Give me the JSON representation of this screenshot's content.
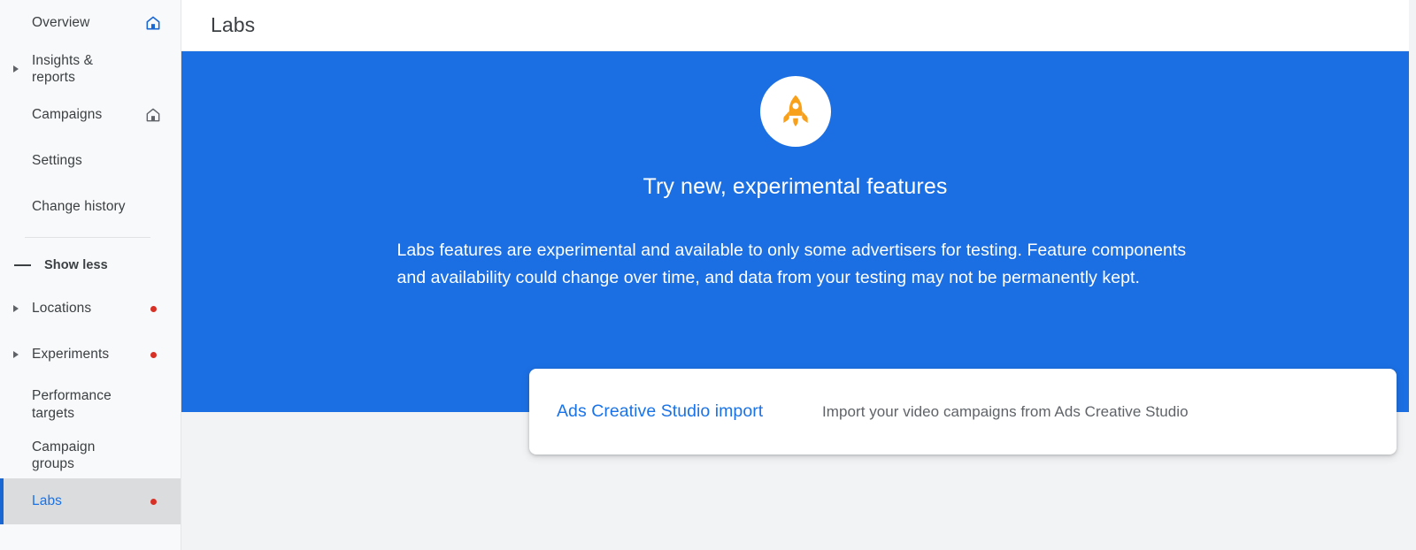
{
  "sidebar": {
    "items": [
      {
        "label": "Overview",
        "caret": false,
        "trailing_icon": "home-icon-blue",
        "dot": false,
        "selected": false,
        "two_line": false
      },
      {
        "label": "Insights & reports",
        "caret": true,
        "trailing_icon": "",
        "dot": false,
        "selected": false,
        "two_line": false
      },
      {
        "label": "Campaigns",
        "caret": false,
        "trailing_icon": "home-icon-gray",
        "dot": false,
        "selected": false,
        "two_line": false
      },
      {
        "label": "Settings",
        "caret": false,
        "trailing_icon": "",
        "dot": false,
        "selected": false,
        "two_line": false
      },
      {
        "label": "Change history",
        "caret": false,
        "trailing_icon": "",
        "dot": false,
        "selected": false,
        "two_line": false
      }
    ],
    "show_less": {
      "label": "Show less",
      "icon": "minus-icon"
    },
    "items_after": [
      {
        "label": "Locations",
        "caret": true,
        "trailing_icon": "",
        "dot": true,
        "selected": false,
        "two_line": false
      },
      {
        "label": "Experiments",
        "caret": true,
        "trailing_icon": "",
        "dot": true,
        "selected": false,
        "two_line": false
      },
      {
        "label": "Performance targets",
        "caret": false,
        "trailing_icon": "",
        "dot": false,
        "selected": false,
        "two_line": true
      },
      {
        "label": "Campaign groups",
        "caret": false,
        "trailing_icon": "",
        "dot": false,
        "selected": false,
        "two_line": false
      },
      {
        "label": "Labs",
        "caret": false,
        "trailing_icon": "",
        "dot": true,
        "selected": true,
        "two_line": false
      }
    ]
  },
  "header": {
    "title": "Labs"
  },
  "hero": {
    "icon": "rocket-icon",
    "heading": "Try new, experimental features",
    "body": "Labs features are experimental and available to only some advertisers for testing. Feature components and availability could change over time, and data from your testing may not be permanently kept."
  },
  "card": {
    "link_label": "Ads Creative Studio import",
    "description": "Import your video campaigns from Ads Creative Studio"
  },
  "colors": {
    "hero_blue": "#1b6fe3",
    "accent_blue": "#1a73e8",
    "selected_border": "#1967d2",
    "selected_bg": "#dbdcde",
    "rocket_orange": "#f9a01b",
    "dot_red": "#d93025",
    "page_bg": "#f1f3f4",
    "sidebar_bg": "#f8f9fa",
    "text_primary": "#3c4043",
    "text_secondary": "#5f6368"
  }
}
